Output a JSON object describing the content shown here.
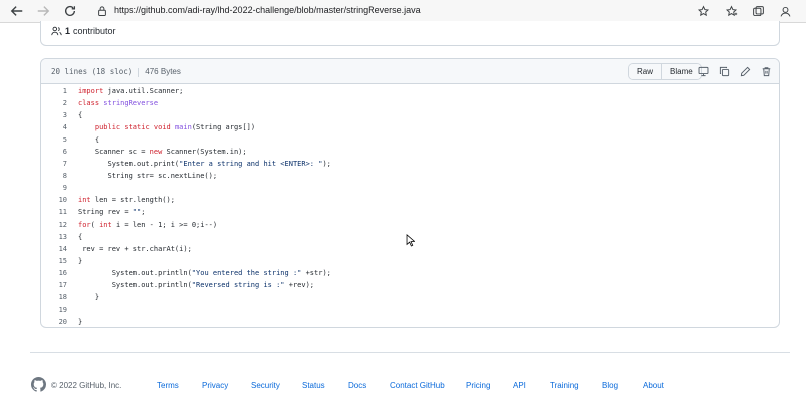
{
  "browser": {
    "url": "https://github.com/adi-ray/lhd-2022-challenge/blob/master/stringReverse.java"
  },
  "contributors": {
    "count": "1",
    "label": "contributor"
  },
  "file": {
    "lines_info": "20 lines (18 sloc)",
    "size": "476 Bytes",
    "raw_label": "Raw",
    "blame_label": "Blame"
  },
  "code_lines": [
    "import java.util.Scanner;",
    "class stringReverse",
    "{",
    "    public static void main(String args[])",
    "    {",
    "    Scanner sc = new Scanner(System.in);",
    "       System.out.print(\"Enter a string and hit <ENTER>: \");",
    "       String str= sc.nextLine();",
    "",
    "int len = str.length();",
    "String rev = \"\";",
    "for( int i = len - 1; i >= 0;i--)",
    "{",
    " rev = rev + str.charAt(i);",
    "}",
    "        System.out.println(\"You entered the string :\" +str);",
    "        System.out.println(\"Reversed string is :\" +rev);",
    "    }",
    "",
    "}"
  ],
  "line_numbers": [
    "1",
    "2",
    "3",
    "4",
    "5",
    "6",
    "7",
    "8",
    "9",
    "10",
    "11",
    "12",
    "13",
    "14",
    "15",
    "16",
    "17",
    "18",
    "19",
    "20"
  ],
  "footer": {
    "copyright": "© 2022 GitHub, Inc.",
    "links": [
      "Terms",
      "Privacy",
      "Security",
      "Status",
      "Docs",
      "Contact GitHub",
      "Pricing",
      "API",
      "Training",
      "Blog",
      "About"
    ]
  },
  "colors": {
    "link": "#0969da",
    "keyword": "#cf222e",
    "entity": "#8250df",
    "string": "#0a3069"
  }
}
